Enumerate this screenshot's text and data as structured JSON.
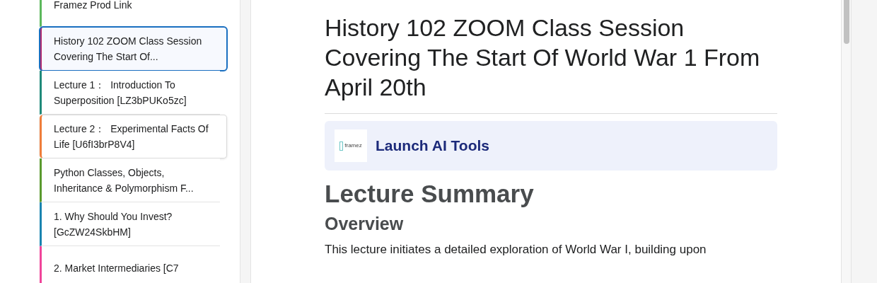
{
  "sidebar": {
    "items": [
      {
        "label": "Framez Prod Link",
        "color": "#5cb85c",
        "selected": false,
        "hovered": false
      },
      {
        "label": "History 102 ZOOM Class Session Covering The Start Of...",
        "color": "#b0286e",
        "selected": true,
        "hovered": false
      },
      {
        "label": "Lecture 1：  Introduction To Superposition [LZ3bPUKo5zc]",
        "color": "#1f8a7a",
        "selected": false,
        "hovered": false
      },
      {
        "label": "Lecture 2：  Experimental Facts Of Life [U6fI3brP8V4]",
        "color": "#ef7d3a",
        "selected": false,
        "hovered": true
      },
      {
        "label": "Python Classes, Objects, Inheritance & Polymorphism F...",
        "color": "#5a9a2e",
        "selected": false,
        "hovered": false
      },
      {
        "label": "1. Why Should You Invest? [GcZW24SkbHM]",
        "color": "#1a84b0",
        "selected": false,
        "hovered": false
      },
      {
        "label": "2. Market Intermediaries [C7",
        "color": "#f0449a",
        "selected": false,
        "hovered": false
      }
    ]
  },
  "content": {
    "title": "History 102 ZOOM Class Session Covering The Start Of World War 1 From April 20th",
    "launch": {
      "logo_text": "framez",
      "label": "Launch AI Tools"
    },
    "heading": "Lecture Summary",
    "subheading": "Overview",
    "paragraph": "This lecture initiates a detailed exploration of World War I, building upon"
  }
}
